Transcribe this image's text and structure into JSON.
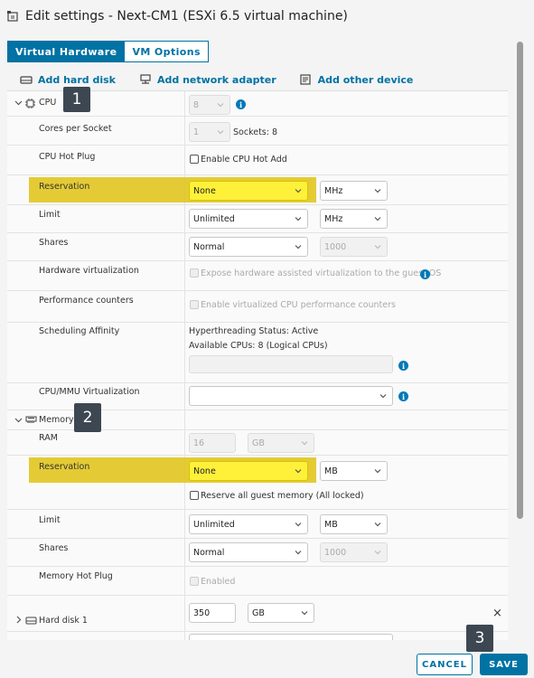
{
  "window": {
    "title": "Edit settings - Next-CM1 (ESXi 6.5 virtual machine)"
  },
  "tabs": [
    {
      "label": "Virtual Hardware",
      "active": true
    },
    {
      "label": "VM Options",
      "active": false
    }
  ],
  "toolbar": {
    "add_hard_disk": "Add hard disk",
    "add_network_adapter": "Add network adapter",
    "add_other_device": "Add other device"
  },
  "cpu": {
    "label": "CPU",
    "count": "8",
    "cores_per_socket_label": "Cores per Socket",
    "cores_per_socket": "1",
    "sockets_text": "Sockets: 8",
    "hot_plug_label": "CPU Hot Plug",
    "hot_plug_checkbox": "Enable CPU Hot Add",
    "reservation_label": "Reservation",
    "reservation_value": "None",
    "reservation_unit": "MHz",
    "limit_label": "Limit",
    "limit_value": "Unlimited",
    "limit_unit": "MHz",
    "shares_label": "Shares",
    "shares_value": "Normal",
    "shares_amount": "1000",
    "hw_virt_label": "Hardware virtualization",
    "hw_virt_checkbox": "Expose hardware assisted virtualization to the guest OS",
    "perf_label": "Performance counters",
    "perf_checkbox": "Enable virtualized CPU performance counters",
    "sched_label": "Scheduling Affinity",
    "hyperthreading": "Hyperthreading Status: Active",
    "available_cpus": "Available CPUs: 8 (Logical CPUs)",
    "affinity_value": "",
    "mmu_label": "CPU/MMU Virtualization",
    "mmu_value": ""
  },
  "memory": {
    "label": "Memory",
    "ram_label": "RAM",
    "ram_value": "16",
    "ram_unit": "GB",
    "reservation_label": "Reservation",
    "reservation_value": "None",
    "reservation_unit": "MB",
    "reserve_all": "Reserve all guest memory (All locked)",
    "limit_label": "Limit",
    "limit_value": "Unlimited",
    "limit_unit": "MB",
    "shares_label": "Shares",
    "shares_value": "Normal",
    "shares_amount": "1000",
    "hot_plug_label": "Memory Hot Plug",
    "hot_plug_checkbox": "Enabled"
  },
  "hard_disk": {
    "label": "Hard disk 1",
    "size": "350",
    "unit": "GB",
    "remove": "×"
  },
  "badges": {
    "one": "1",
    "two": "2",
    "three": "3"
  },
  "footer": {
    "cancel": "CANCEL",
    "save": "SAVE"
  },
  "colors": {
    "accent": "#0072a3",
    "highlight": "#e1c51f",
    "field_highlight": "#fff13a",
    "badge": "#3d4752"
  }
}
